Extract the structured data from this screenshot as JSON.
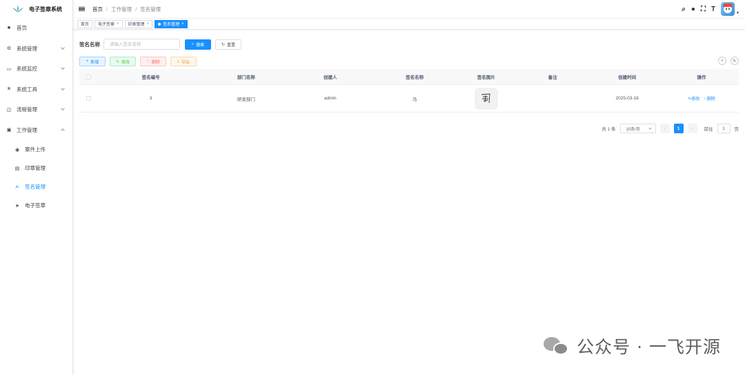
{
  "app": {
    "title": "电子签章系统"
  },
  "sidebar": {
    "items": [
      {
        "label": "首页",
        "icon": "dashboard-icon",
        "glyph": "■",
        "expandable": false
      },
      {
        "label": "系统管理",
        "icon": "gear-icon",
        "glyph": "⚙",
        "expandable": true,
        "expanded": false
      },
      {
        "label": "系统监控",
        "icon": "monitor-icon",
        "glyph": "▭",
        "expandable": true,
        "expanded": false
      },
      {
        "label": "系统工具",
        "icon": "toolbox-icon",
        "glyph": "⧈",
        "expandable": true,
        "expanded": false
      },
      {
        "label": "流程管理",
        "icon": "flow-icon",
        "glyph": "◫",
        "expandable": true,
        "expanded": false
      },
      {
        "label": "工作管理",
        "icon": "briefcase-icon",
        "glyph": "▣",
        "expandable": true,
        "expanded": true
      }
    ],
    "sub_items": [
      {
        "label": "案件上传",
        "icon": "upload-icon",
        "glyph": "◉",
        "active": false
      },
      {
        "label": "印章管理",
        "icon": "seal-icon",
        "glyph": "▤",
        "active": false
      },
      {
        "label": "签名管理",
        "icon": "signature-icon",
        "glyph": "✍",
        "active": true
      },
      {
        "label": "电子签章",
        "icon": "send-icon",
        "glyph": "➤",
        "active": false
      }
    ]
  },
  "header": {
    "breadcrumb": [
      "首页",
      "工作管理",
      "签名管理"
    ]
  },
  "tags": [
    {
      "label": "首页",
      "closable": false,
      "active": false
    },
    {
      "label": "电子签章",
      "closable": true,
      "active": false
    },
    {
      "label": "印章管理",
      "closable": true,
      "active": false
    },
    {
      "label": "签名管理",
      "closable": true,
      "active": true
    }
  ],
  "search": {
    "label": "签名名称",
    "placeholder": "请输入签名名称",
    "search_button": "搜索",
    "reset_button": "重置"
  },
  "actions": {
    "add": "新增",
    "edit": "修改",
    "delete": "删除",
    "export": "导出"
  },
  "table": {
    "headers": {
      "id": "签名编号",
      "dept": "部门名称",
      "creator": "创建人",
      "name": "签名名称",
      "image": "签名图片",
      "remark": "备注",
      "created": "创建时间",
      "ops": "操作"
    },
    "rows": [
      {
        "id": "3",
        "dept": "研发部门",
        "creator": "admin",
        "name": "马",
        "remark": "",
        "created": "2025-03-18",
        "edit": "修改",
        "delete": "删除"
      }
    ]
  },
  "pagination": {
    "total": "共 1 条",
    "page_size": "10条/页",
    "current": "1",
    "goto_prefix": "前往",
    "goto_value": "1",
    "goto_suffix": "页"
  },
  "watermark": {
    "text": "公众号 · 一飞开源"
  },
  "colors": {
    "primary": "#1890ff",
    "success": "#67c23a",
    "danger": "#f56c6c",
    "warning": "#e6a23c"
  }
}
